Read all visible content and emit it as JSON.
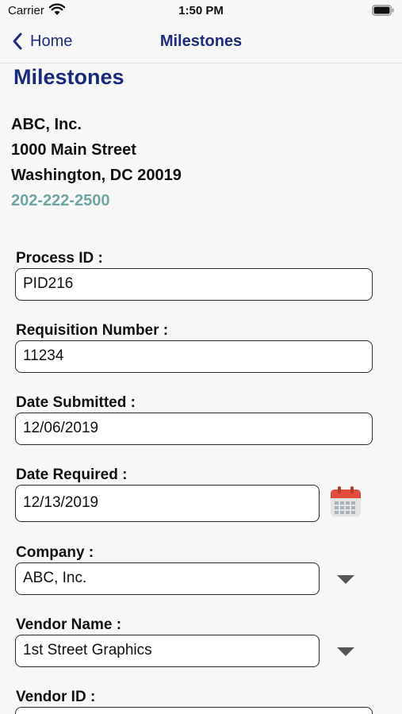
{
  "status_bar": {
    "carrier": "Carrier",
    "time": "1:50 PM"
  },
  "nav": {
    "back_label": "Home",
    "title": "Milestones"
  },
  "page": {
    "title": "Milestones"
  },
  "company": {
    "name": "ABC, Inc.",
    "street": "1000 Main Street",
    "city_state_zip": "Washington, DC 20019",
    "phone": "202-222-2500"
  },
  "form": {
    "process_id": {
      "label": "Process ID :",
      "value": "PID216"
    },
    "requisition_number": {
      "label": "Requisition Number :",
      "value": "11234"
    },
    "date_submitted": {
      "label": "Date Submitted :",
      "value": "12/06/2019"
    },
    "date_required": {
      "label": "Date Required :",
      "value": "12/13/2019"
    },
    "company": {
      "label": "Company :",
      "value": "ABC, Inc."
    },
    "vendor_name": {
      "label": "Vendor Name :",
      "value": "1st Street Graphics"
    },
    "vendor_id": {
      "label": "Vendor ID :",
      "value": ""
    }
  },
  "colors": {
    "accent": "#1e2d7d",
    "phone": "#6ea6a0",
    "calendar_red": "#e34b3c"
  },
  "icons": [
    "wifi-icon",
    "battery-icon",
    "back-chevron-icon",
    "calendar-icon",
    "dropdown-icon"
  ]
}
